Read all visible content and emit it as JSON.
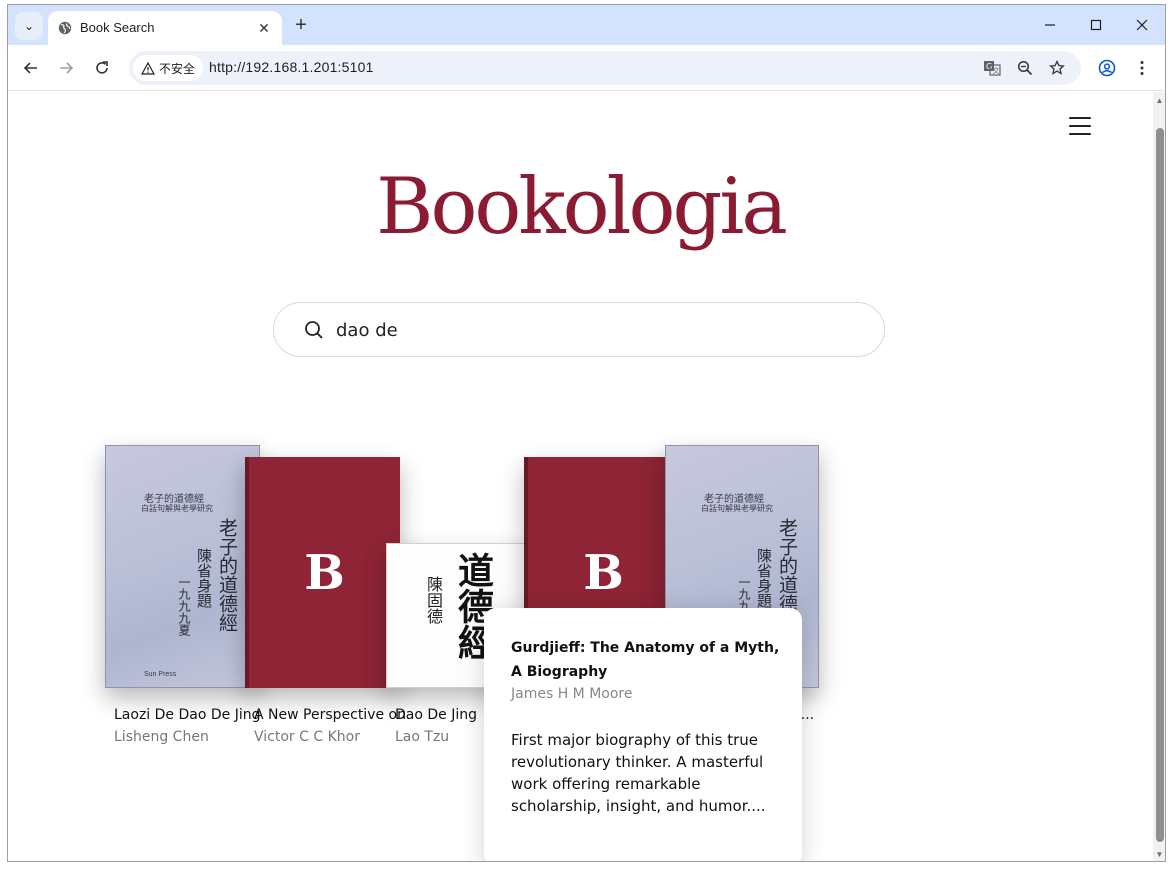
{
  "browser": {
    "tab_title": "Book Search",
    "security_label": "不安全",
    "url": "http://192.168.1.201:5101"
  },
  "site": {
    "logo": "Bookologia",
    "search_query": "dao de"
  },
  "books": [
    {
      "title": "Laozi De Dao De Jing",
      "author": "Lisheng Chen",
      "cover": "lavender",
      "cover_text": {
        "top": "老子的道德經",
        "sub": "白話句解與老學研究",
        "vertical": "老子的道德經",
        "vertical2": "陳省身題",
        "vertical3": "一九九九夏",
        "publisher": "Sun Press"
      }
    },
    {
      "title": "A New Perspective on",
      "author": "Victor C C Khor",
      "cover": "red",
      "cover_letter": "B"
    },
    {
      "title": "Dao De Jing",
      "author": "Lao Tzu",
      "cover": "white",
      "cover_text": {
        "big": "道德經",
        "small": "陳固德"
      }
    },
    {
      "title": "",
      "author": "",
      "cover": "red",
      "cover_letter": "B"
    },
    {
      "title": "ng...",
      "author": "",
      "cover": "lavender",
      "cover_text": {
        "top": "老子的道德經",
        "sub": "白話句解與老學研究",
        "vertical": "老子的道德經",
        "vertical2": "陳省身題",
        "vertical3": "一九九九夏"
      }
    }
  ],
  "popover": {
    "title": "Gurdjieff: The Anatomy of a Myth, A Biography",
    "author": "James H M Moore",
    "description": "First major biography of this true revolutionary thinker. A masterful work offering remarkable scholarship, insight, and humor...."
  },
  "colors": {
    "brand": "#8b1a33",
    "tab_strip": "#d3e3fd",
    "omnibox": "#edf2fa"
  }
}
